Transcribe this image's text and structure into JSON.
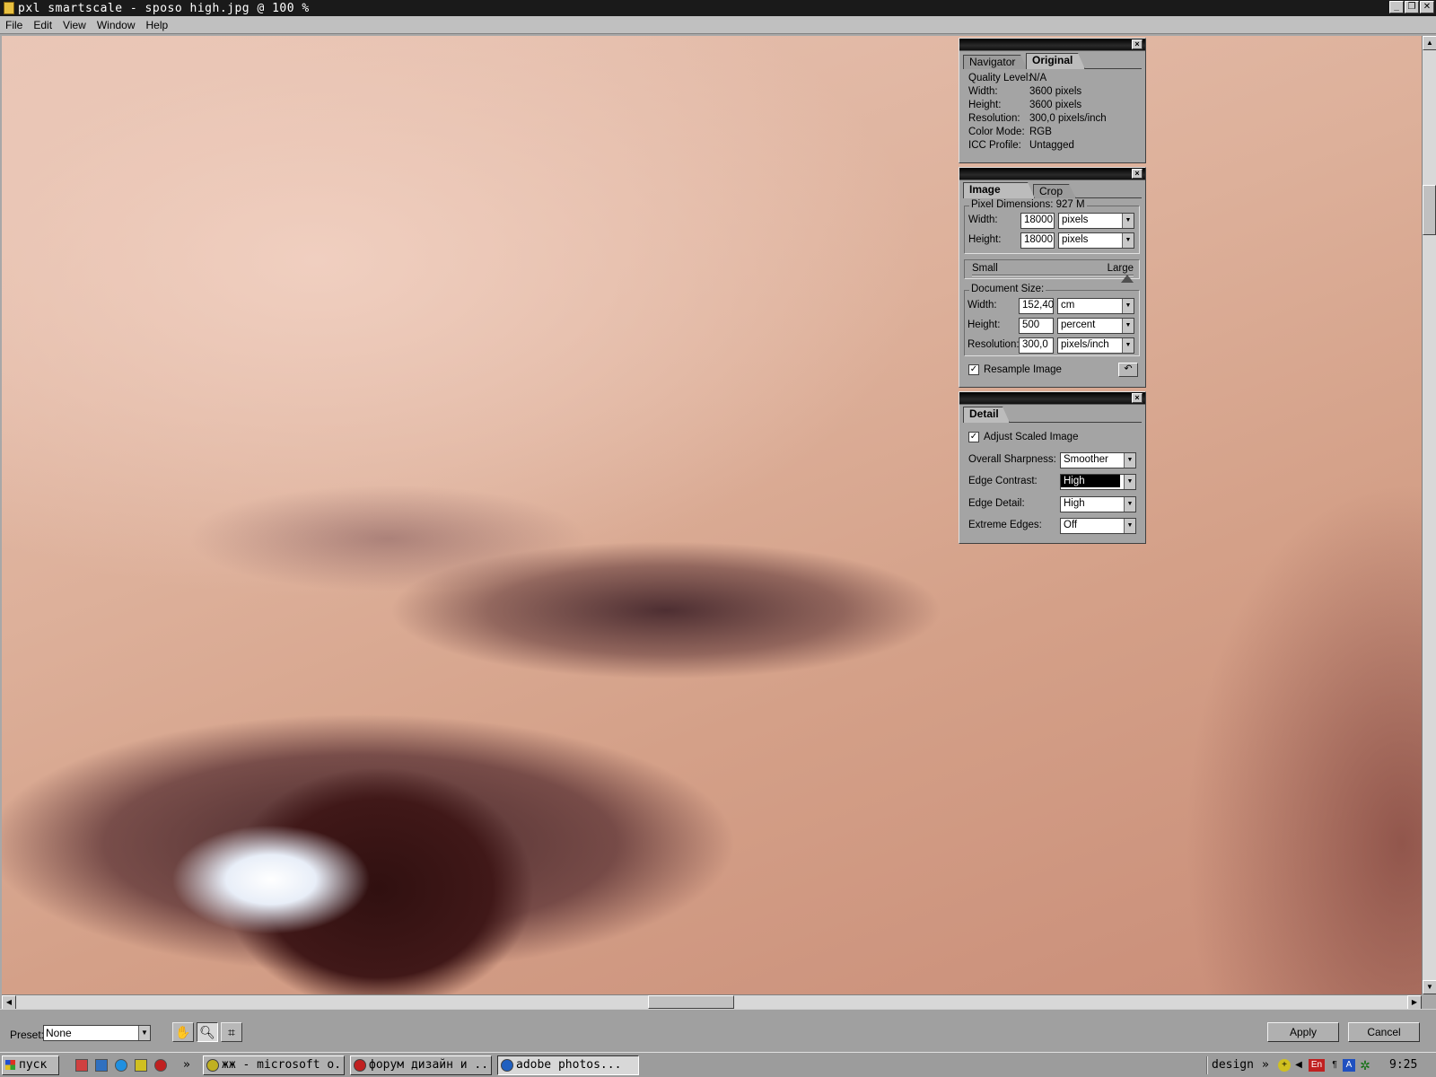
{
  "window": {
    "title": "pxl smartscale - sposo high.jpg @ 100 %",
    "min": "_",
    "max": "❐",
    "close": "✕"
  },
  "menu": [
    "File",
    "Edit",
    "View",
    "Window",
    "Help"
  ],
  "original_panel": {
    "tabs": [
      "Navigator",
      "Original"
    ],
    "rows": [
      {
        "k": "Quality Level:",
        "v": "N/A"
      },
      {
        "k": "Width:",
        "v": "3600 pixels"
      },
      {
        "k": "Height:",
        "v": "3600 pixels"
      },
      {
        "k": "Resolution:",
        "v": "300,0 pixels/inch"
      },
      {
        "k": "Color Mode:",
        "v": "RGB"
      },
      {
        "k": "ICC Profile:",
        "v": "Untagged"
      }
    ]
  },
  "image_size_panel": {
    "tabs": [
      "Image Size",
      "Crop"
    ],
    "pixel_dimensions": "Pixel Dimensions: 927 M",
    "px_width_label": "Width:",
    "px_width": "18000",
    "px_width_unit": "pixels",
    "px_height_label": "Height:",
    "px_height": "18000",
    "px_height_unit": "pixels",
    "slider_small": "Small",
    "slider_large": "Large",
    "slider_level": 0.95,
    "document_size": "Document Size:",
    "doc_width_label": "Width:",
    "doc_width": "152,40",
    "doc_width_unit": "cm",
    "doc_height_label": "Height:",
    "doc_height": "500",
    "doc_height_unit": "percent",
    "doc_res_label": "Resolution:",
    "doc_res": "300,0",
    "doc_res_unit": "pixels/inch",
    "resample_label": "Resample Image",
    "resample_checked": "✓"
  },
  "detail_panel": {
    "tabs": [
      "Detail"
    ],
    "adjust_label": "Adjust Scaled Image",
    "adjust_checked": "✓",
    "rows": [
      {
        "k": "Overall Sharpness:",
        "v": "Smoother"
      },
      {
        "k": "Edge Contrast:",
        "v": "High"
      },
      {
        "k": "Edge Detail:",
        "v": "High"
      },
      {
        "k": "Extreme Edges:",
        "v": "Off"
      }
    ]
  },
  "bottom": {
    "preset_label": "Preset:",
    "preset_value": "None",
    "apply": "Apply",
    "cancel": "Cancel"
  },
  "taskbar": {
    "start": "пуск",
    "tasks": [
      "жж - microsoft o...",
      "форум дизайн и ...",
      "adobe photos..."
    ],
    "tray_label": "design",
    "lang": "En",
    "clock": "9:25"
  },
  "icons": {
    "hand": "hand-tool-icon",
    "zoom": "zoom-tool-icon",
    "crop": "crop-tool-icon"
  }
}
